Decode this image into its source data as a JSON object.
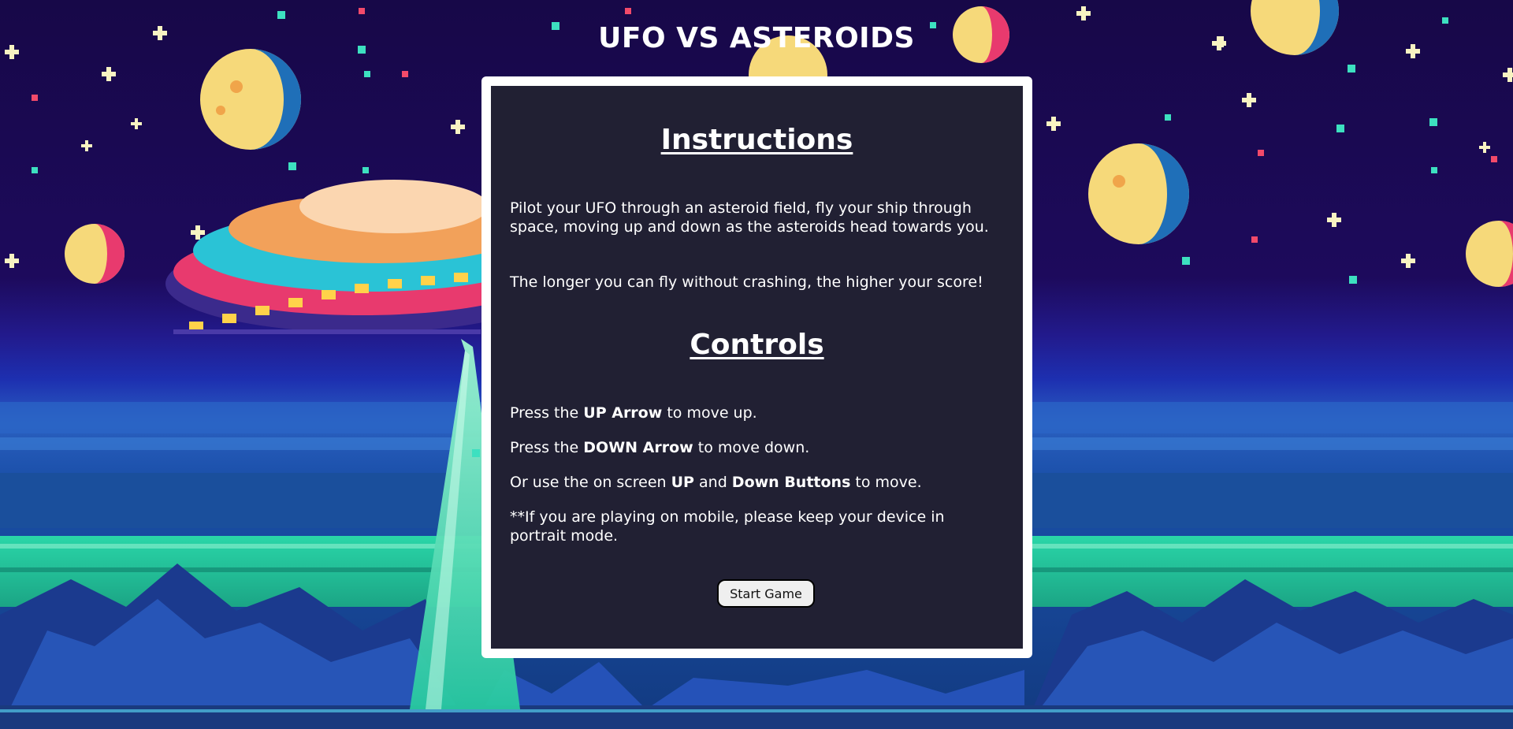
{
  "game": {
    "title": "UFO VS ASTEROIDS"
  },
  "instructions": {
    "heading": "Instructions",
    "paragraphs": [
      "Pilot your UFO through an asteroid field, fly your ship through space, moving up and down as the asteroids head towards you.",
      "The longer you can fly without crashing, the higher your score!"
    ]
  },
  "controls": {
    "heading": "Controls",
    "up": {
      "prefix": "Press the ",
      "key": "UP Arrow",
      "suffix": " to move up."
    },
    "down": {
      "prefix": "Press the ",
      "key": "DOWN Arrow",
      "suffix": " to move down."
    },
    "onscreen": {
      "prefix": "Or use the on screen ",
      "key1": "UP",
      "mid": " and ",
      "key2": "Down Buttons",
      "suffix": " to move."
    },
    "mobile_note": "**If you are playing on mobile, please keep your device in portrait mode."
  },
  "start_button": "Start Game",
  "colors": {
    "sky_dark": "#1a0a4a",
    "panel_bg": "#212033",
    "panel_border": "#ffffff",
    "text": "#ffffff",
    "ground_teal": "#2ad6a8",
    "moon_yellow": "#f6d97a",
    "moon_blue": "#1f6fb8"
  }
}
